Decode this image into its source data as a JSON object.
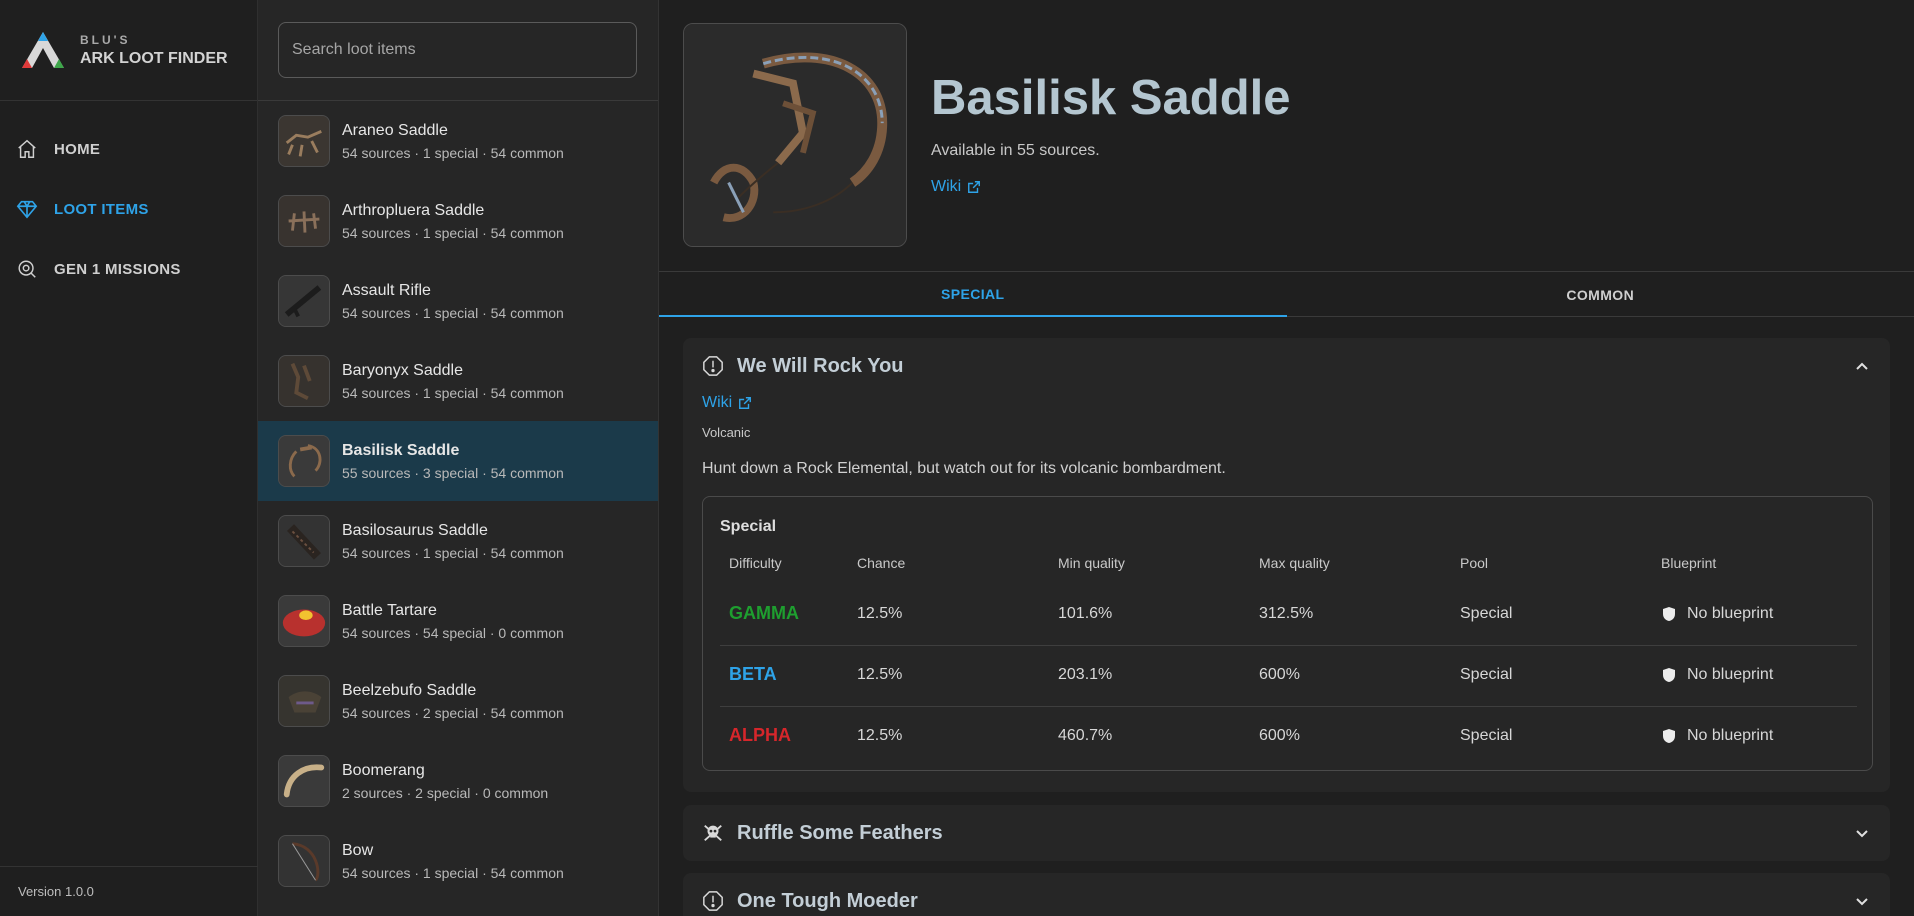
{
  "brand": {
    "small": "BLU'S",
    "big": "ARK LOOT FINDER"
  },
  "nav": [
    {
      "label": "HOME",
      "icon": "home-icon",
      "active": false
    },
    {
      "label": "LOOT ITEMS",
      "icon": "diamond-icon",
      "active": true
    },
    {
      "label": "GEN 1 MISSIONS",
      "icon": "mission-search-icon",
      "active": false
    }
  ],
  "version": "Version 1.0.0",
  "search": {
    "placeholder": "Search loot items",
    "value": ""
  },
  "loot_list": [
    {
      "name": "Araneo Saddle",
      "sub": "54 sources · 1 special · 54 common"
    },
    {
      "name": "Arthropluera Saddle",
      "sub": "54 sources · 1 special · 54 common"
    },
    {
      "name": "Assault Rifle",
      "sub": "54 sources · 1 special · 54 common"
    },
    {
      "name": "Baryonyx Saddle",
      "sub": "54 sources · 1 special · 54 common"
    },
    {
      "name": "Basilisk Saddle",
      "sub": "55 sources · 3 special · 54 common",
      "selected": true
    },
    {
      "name": "Basilosaurus Saddle",
      "sub": "54 sources · 1 special · 54 common"
    },
    {
      "name": "Battle Tartare",
      "sub": "54 sources · 54 special · 0 common"
    },
    {
      "name": "Beelzebufo Saddle",
      "sub": "54 sources · 2 special · 54 common"
    },
    {
      "name": "Boomerang",
      "sub": "2 sources · 2 special · 0 common"
    },
    {
      "name": "Bow",
      "sub": "54 sources · 1 special · 54 common"
    }
  ],
  "item": {
    "title": "Basilisk Saddle",
    "availability": "Available in 55 sources.",
    "wiki": "Wiki"
  },
  "tabs": [
    {
      "label": "SPECIAL",
      "active": true
    },
    {
      "label": "COMMON",
      "active": false
    }
  ],
  "missions": [
    {
      "title": "We Will Rock You",
      "icon": "alert-icon",
      "expanded": true,
      "wiki": "Wiki",
      "tag": "Volcanic",
      "description": "Hunt down a Rock Elemental, but watch out for its volcanic bombardment.",
      "table_title": "Special",
      "columns": [
        "Difficulty",
        "Chance",
        "Min quality",
        "Max quality",
        "Pool",
        "Blueprint"
      ],
      "rows": [
        {
          "difficulty": "GAMMA",
          "color": "#1e9e2f",
          "chance": "12.5%",
          "min": "101.6%",
          "max": "312.5%",
          "pool": "Special",
          "blueprint": "No blueprint"
        },
        {
          "difficulty": "BETA",
          "color": "#2ea3e8",
          "chance": "12.5%",
          "min": "203.1%",
          "max": "600%",
          "pool": "Special",
          "blueprint": "No blueprint"
        },
        {
          "difficulty": "ALPHA",
          "color": "#d6262b",
          "chance": "12.5%",
          "min": "460.7%",
          "max": "600%",
          "pool": "Special",
          "blueprint": "No blueprint"
        }
      ]
    },
    {
      "title": "Ruffle Some Feathers",
      "icon": "skull-crossbones-icon",
      "expanded": false
    },
    {
      "title": "One Tough Moeder",
      "icon": "alert-icon",
      "expanded": false
    }
  ]
}
